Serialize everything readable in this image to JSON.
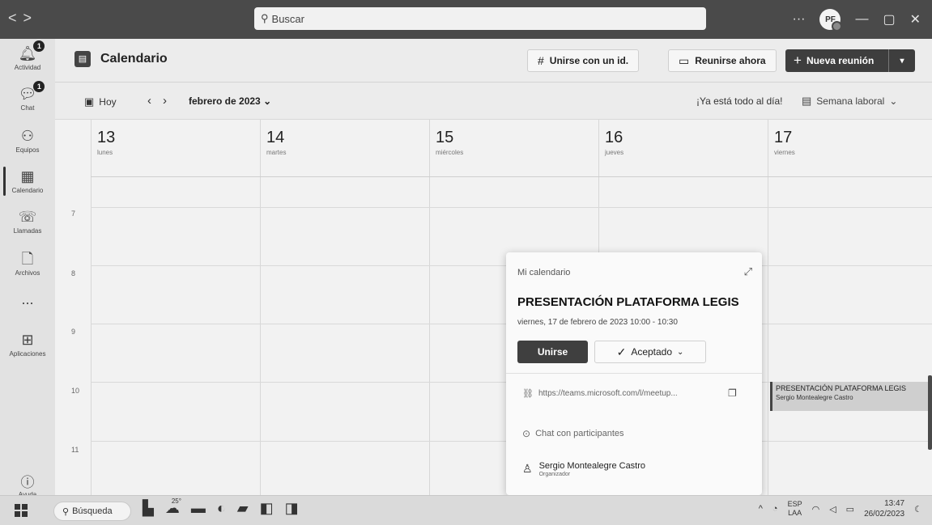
{
  "titlebar": {
    "search_placeholder": "Buscar",
    "avatar_initials": "PF",
    "more": "···"
  },
  "rail": {
    "items": [
      {
        "label": "Actividad",
        "badge": "1"
      },
      {
        "label": "Chat",
        "badge": "1"
      },
      {
        "label": "Equipos"
      },
      {
        "label": "Calendario"
      },
      {
        "label": "Llamadas"
      },
      {
        "label": "Archivos"
      },
      {
        "label": "..."
      },
      {
        "label": "Aplicaciones"
      }
    ],
    "help_label": "Ayuda"
  },
  "header": {
    "title": "Calendario",
    "join_id": "Unirse con un id.",
    "meet_now": "Reunirse ahora",
    "new_meeting": "Nueva reunión"
  },
  "toolbar": {
    "today": "Hoy",
    "month": "febrero de 2023",
    "all_day": "¡Ya está todo al día!",
    "view": "Semana laboral"
  },
  "days": [
    {
      "num": "13",
      "name": "lunes"
    },
    {
      "num": "14",
      "name": "martes"
    },
    {
      "num": "15",
      "name": "miércoles"
    },
    {
      "num": "16",
      "name": "jueves"
    },
    {
      "num": "17",
      "name": "viernes"
    }
  ],
  "hours": [
    "7",
    "8",
    "9",
    "10",
    "11"
  ],
  "event": {
    "title": "PRESENTACIÓN PLATAFORMA LEGIS",
    "organizer": "Sergio Montealegre Castro"
  },
  "popup": {
    "calendar_label": "Mi calendario",
    "title": "PRESENTACIÓN PLATAFORMA LEGIS",
    "datetime": "viernes, 17 de febrero de 2023 10:00 - 10:30",
    "join": "Unirse",
    "rsvp": "Aceptado",
    "link": "https://teams.microsoft.com/l/meetup...",
    "chat": "Chat con participantes",
    "organizer_name": "Sergio Montealegre Castro",
    "organizer_role": "Organizador"
  },
  "taskbar": {
    "search": "Búsqueda",
    "weather": "25°",
    "lang_top": "ESP",
    "lang_bottom": "LAA",
    "time": "13:47",
    "date": "26/02/2023"
  }
}
